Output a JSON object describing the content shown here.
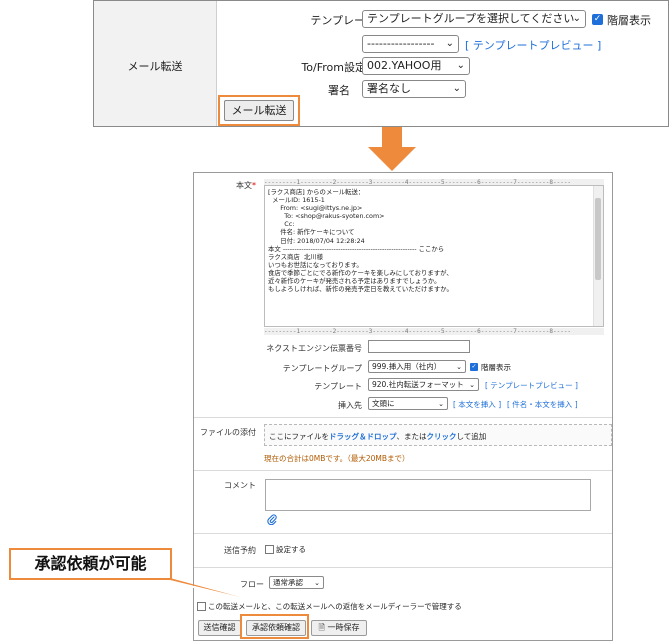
{
  "top_panel": {
    "section_label": "メール転送",
    "template_label": "テンプレート",
    "template_group_select": "テンプレートグループを選択してください",
    "hierarchy_checkbox_label": "階層表示",
    "template_select": "-----------------",
    "template_preview_link": "[ テンプレートプレビュー ]",
    "to_from_label": "To/From設定",
    "to_from_select": "002.YAHOO用",
    "signature_label": "署名",
    "signature_select": "署名なし",
    "mail_forward_button": "メール転送"
  },
  "form": {
    "body_label": "本文",
    "required_mark": "*",
    "ruler_text": "---------1---------2---------3---------4---------5---------6---------7---------8-----",
    "body_lines": [
      "[ラクス商店] からのメール転送：",
      "  メールID: 1615-1",
      "      From: <sugi@ittys.ne.jp>",
      "        To: <shop@rakus-syoten.com>",
      "        Cc:",
      "      件名: 新作ケーキについて",
      "      日付: 2018/07/04 12:28:24",
      "本文 ---------------------------------------------------------- ここから",
      "ラクス商店  北川様",
      "",
      "いつもお世話になっております。",
      "",
      "食店で季節ごとにでる新作のケーキを楽しみにしておりますが、",
      "近々新作のケーキが発売される予定はありますでしょうか。",
      "",
      "もしよろしければ、新作の発売予定日を教えていただけますか。"
    ],
    "next_engine_label": "ネクストエンジン伝票番号",
    "next_engine_value": "",
    "template_group_label": "テンプレートグループ",
    "template_group_select": "999.挿入用（社内）",
    "hierarchy_checkbox_label": "階層表示",
    "template_label": "テンプレート",
    "template_select": "920.社内転送フォーマット",
    "template_preview_link": "[ テンプレートプレビュー ]",
    "insert_position_label": "挿入先",
    "insert_position_select": "文頭に",
    "insert_body_link": "[ 本文を挿入 ]",
    "insert_subject_body_link": "[ 件名・本文を挿入 ]",
    "attachment_label": "ファイルの添付",
    "dropzone_prefix": "ここにファイルを",
    "dropzone_drag": "ドラッグ＆ドロップ",
    "dropzone_mid": "、または",
    "dropzone_click": "クリック",
    "dropzone_suffix": "して追加",
    "attachment_total": "現在の合計は0MBです。（最大20MBまで）",
    "comment_label": "コメント",
    "schedule_label": "送信予約",
    "schedule_checkbox_label": "設定する",
    "flow_label": "フロー",
    "flow_select": "通常承認",
    "manage_checkbox_label": "この転送メールと、この転送メールへの返信をメールディーラーで管理する",
    "send_confirm_button": "送信確認",
    "approval_request_button": "承認依頼確認",
    "temp_save_button": "一時保存",
    "accent_color": "#1e6fd9",
    "attachment_note_color": "#b05a00"
  },
  "callout": {
    "text": "承認依頼が可能",
    "border_color": "#ee8a3b"
  }
}
